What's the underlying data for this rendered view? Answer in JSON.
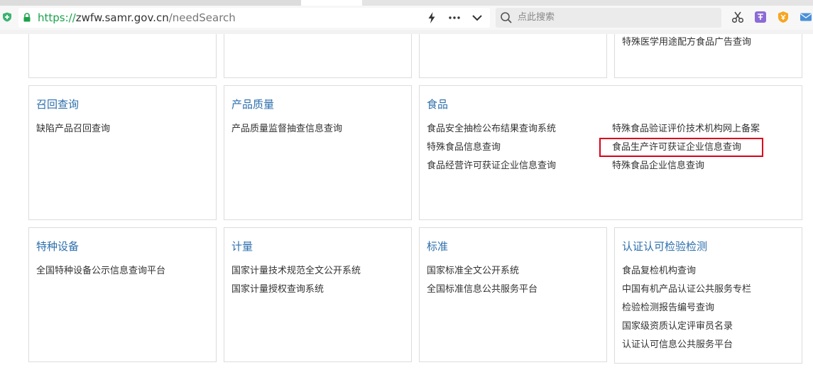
{
  "browser": {
    "url_scheme": "https://",
    "url_host": "zwfw.samr.gov.cn",
    "url_path": "/needSearch",
    "search_placeholder": "点此搜索",
    "icons": [
      "shield-extension-icon",
      "lock-icon",
      "lightning-icon",
      "more-icon",
      "chevron-down-icon",
      "search-icon",
      "scissors-icon",
      "translate-icon",
      "coupon-extension-icon",
      "mail-icon"
    ]
  },
  "top_partial_panels": [
    {
      "links": []
    },
    {
      "links": []
    },
    {
      "links": []
    },
    {
      "links": [
        "特殊医学用途配方食品广告查询"
      ]
    }
  ],
  "recall": {
    "title": "召回查询",
    "links": [
      "缺陷产品召回查询"
    ]
  },
  "quality": {
    "title": "产品质量",
    "links": [
      "产品质量监督抽查信息查询"
    ]
  },
  "food": {
    "title": "食品",
    "left_links": [
      "食品安全抽检公布结果查询系统",
      "特殊食品信息查询",
      "食品经营许可获证企业信息查询"
    ],
    "right_links": [
      "特殊食品验证评价技术机构网上备案",
      "食品生产许可获证企业信息查询",
      "特殊食品企业信息查询"
    ],
    "highlighted_link": "食品生产许可获证企业信息查询",
    "highlight_color": "#d9001b"
  },
  "equipment": {
    "title": "特种设备",
    "links": [
      "全国特种设备公示信息查询平台"
    ]
  },
  "metrology": {
    "title": "计量",
    "links": [
      "国家计量技术规范全文公开系统",
      "国家计量授权查询系统"
    ]
  },
  "standards": {
    "title": "标准",
    "links": [
      "国家标准全文公开系统",
      "全国标准信息公共服务平台"
    ]
  },
  "certification": {
    "title": "认证认可检验检测",
    "links": [
      "食品复检机构查询",
      "中国有机产品认证公共服务专栏",
      "检验检测报告编号查询",
      "国家级资质认定评审员名录",
      "认证认可信息公共服务平台"
    ]
  },
  "colors": {
    "title_blue": "#2d6fad",
    "link_text": "#333333",
    "border": "#dcdcdc",
    "url_green": "#1aa34a"
  }
}
